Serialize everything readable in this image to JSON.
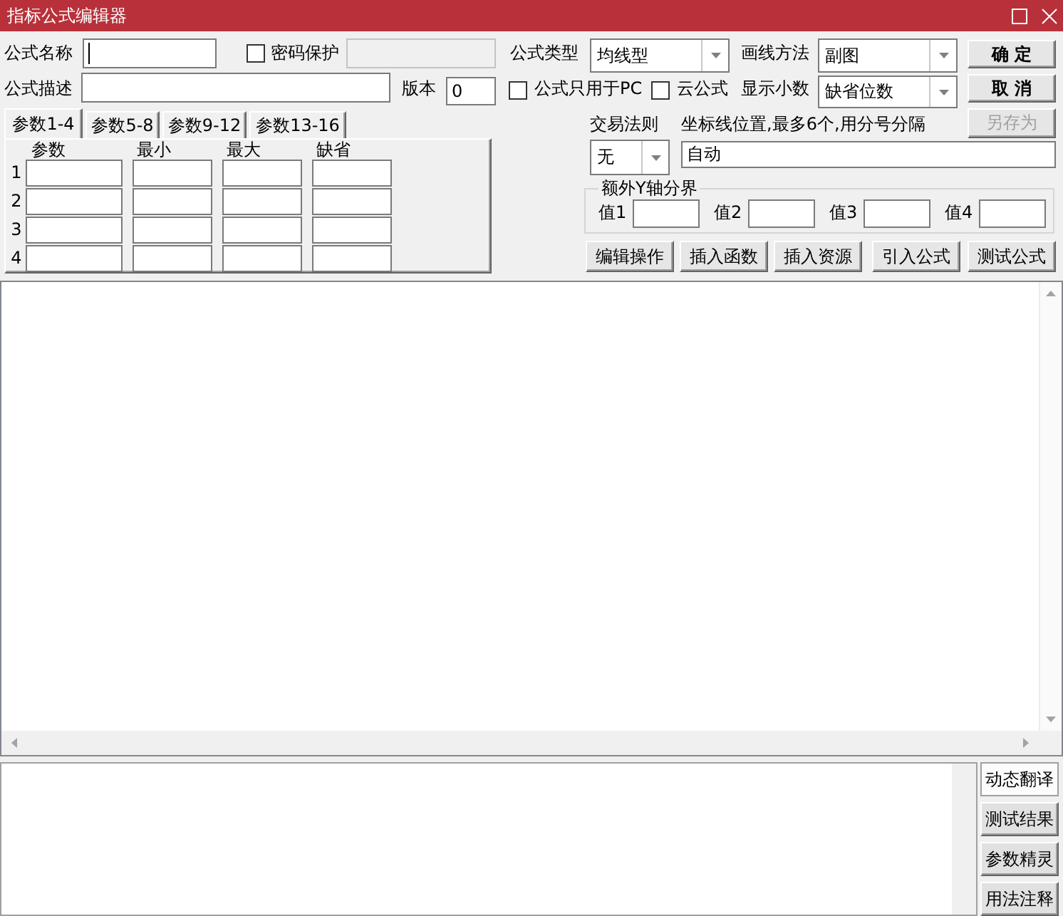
{
  "window": {
    "title": "指标公式编辑器"
  },
  "form": {
    "name": {
      "label": "公式名称",
      "focused": true
    },
    "password": {
      "label": "密码保护",
      "checked": false,
      "field_disabled": true
    },
    "formula_type": {
      "label": "公式类型",
      "value": "均线型"
    },
    "draw_method": {
      "label": "画线方法",
      "value": "副图"
    },
    "description": {
      "label": "公式描述"
    },
    "version": {
      "label": "版本",
      "value": "0"
    },
    "pc_only": {
      "label": "公式只用于PC",
      "checked": false
    },
    "cloud": {
      "label": "云公式",
      "checked": false
    },
    "decimals": {
      "label": "显示小数",
      "value": "缺省位数"
    },
    "trade_rule": {
      "label": "交易法则",
      "value": "无"
    },
    "axis_lines": {
      "label": "坐标线位置,最多6个,用分号分隔",
      "value": "自动"
    },
    "extra_y_axis": {
      "title": "额外Y轴分界",
      "fields": [
        {
          "label": "值1"
        },
        {
          "label": "值2"
        },
        {
          "label": "值3"
        },
        {
          "label": "值4"
        }
      ]
    }
  },
  "side_buttons": [
    {
      "label": "确 定",
      "disabled": false
    },
    {
      "label": "取 消",
      "disabled": false
    },
    {
      "label": "另存为",
      "disabled": true
    }
  ],
  "param_tabs": [
    {
      "label": "参数1-4",
      "selected": true
    },
    {
      "label": "参数5-8",
      "selected": false
    },
    {
      "label": "参数9-12",
      "selected": false
    },
    {
      "label": "参数13-16",
      "selected": false
    }
  ],
  "param_table": {
    "columns": [
      "参数",
      "最小",
      "最大",
      "缺省"
    ],
    "rows": [
      "1",
      "2",
      "3",
      "4"
    ]
  },
  "tool_buttons": [
    "编辑操作",
    "插入函数",
    "插入资源",
    "引入公式",
    "测试公式"
  ],
  "output_buttons": [
    {
      "label": "动态翻译",
      "selected": true
    },
    {
      "label": "测试结果",
      "selected": false
    },
    {
      "label": "参数精灵",
      "selected": false
    },
    {
      "label": "用法注释",
      "selected": false
    }
  ]
}
